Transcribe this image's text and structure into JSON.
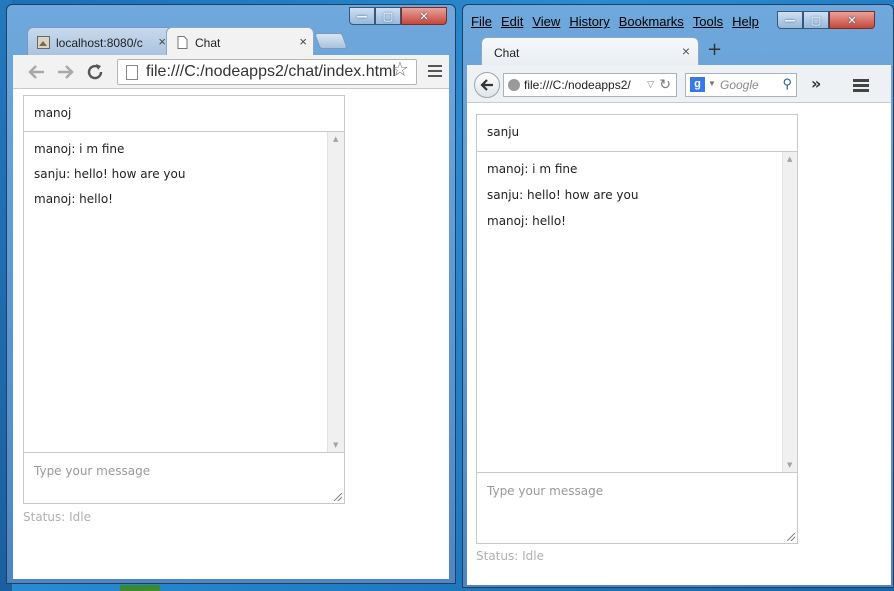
{
  "chrome": {
    "tabs": [
      {
        "label": "localhost:8080/c",
        "active": false
      },
      {
        "label": "Chat",
        "active": true
      }
    ],
    "tab_close_glyph": "×",
    "address": "file:///C:/nodeapps2/chat/index.html",
    "window_controls": {
      "minimize": "—",
      "maximize": "▢",
      "close": "✕"
    }
  },
  "firefox": {
    "menu": [
      "File",
      "Edit",
      "View",
      "History",
      "Bookmarks",
      "Tools",
      "Help"
    ],
    "tab_label": "Chat",
    "tab_close_glyph": "×",
    "new_tab_glyph": "+",
    "address": "file:///C:/nodeapps2/",
    "search_placeholder": "Google",
    "window_controls": {
      "minimize": "—",
      "maximize": "▢",
      "close": "✕"
    }
  },
  "chat_left": {
    "name": "manoj",
    "messages": [
      "manoj: i m fine",
      "sanju: hello! how are you",
      "manoj: hello!"
    ],
    "input_placeholder": "Type your message",
    "status": "Status: Idle"
  },
  "chat_right": {
    "name": "sanju",
    "messages": [
      "manoj: i m fine",
      "sanju: hello! how are you",
      "manoj: hello!"
    ],
    "input_placeholder": "Type your message",
    "status": "Status: Idle"
  },
  "icons": [
    "back-arrow-icon",
    "forward-arrow-icon",
    "reload-icon",
    "page-icon",
    "star-icon",
    "menu-icon",
    "globe-icon",
    "google-icon",
    "search-icon",
    "overflow-chevron-icon"
  ],
  "colors": {
    "window_frame": "#5b95cf",
    "desktop": "#1b6fb3",
    "status_text": "#b0b0b0",
    "placeholder": "#999999"
  }
}
